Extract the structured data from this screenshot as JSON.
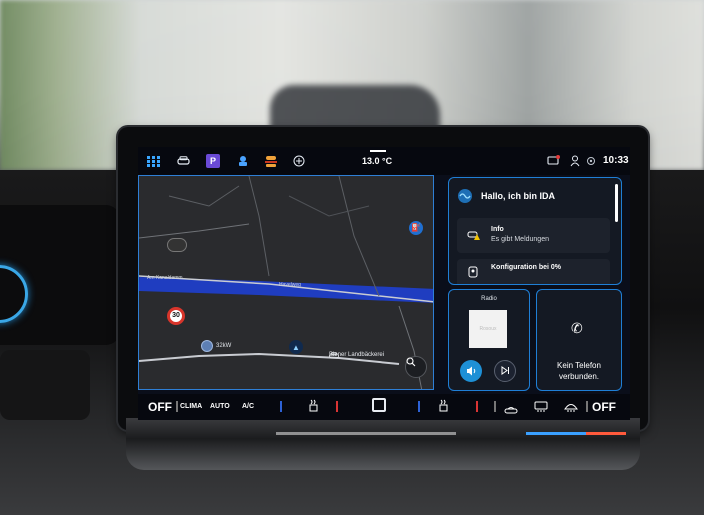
{
  "status_bar": {
    "temperature": "13.0 °C",
    "time": "10:33",
    "icons": [
      "apps-grid-icon",
      "car-icon",
      "parking-icon",
      "seat-comfort-icon",
      "food-icon",
      "add-icon",
      "message-icon",
      "user-icon",
      "settings-icon"
    ]
  },
  "map": {
    "street_1": "Am Kanaldamm",
    "street_2": "Havelweg",
    "speed_limit": "30",
    "charging_power": "32kW",
    "poi_label": "Biener Landbäckerei"
  },
  "ida_panel": {
    "greeting": "Hallo, ich bin IDA",
    "cards": [
      {
        "title": "Info",
        "subtitle": "Es gibt Meldungen"
      },
      {
        "title": "Konfiguration bei 0%",
        "subtitle": ""
      }
    ]
  },
  "radio_panel": {
    "title": "Radio",
    "cover_text": "Rosoux"
  },
  "phone_panel": {
    "message": "Kein Telefon verbunden."
  },
  "climate_bar": {
    "left_off": "OFF",
    "clima": "CLIMA",
    "auto": "AUTO",
    "ac": "A/C",
    "right_off": "OFF"
  },
  "colors": {
    "accent_blue": "#1f7fd6",
    "route_blue": "#1e3fd0",
    "notification_red": "#e23b3b"
  }
}
